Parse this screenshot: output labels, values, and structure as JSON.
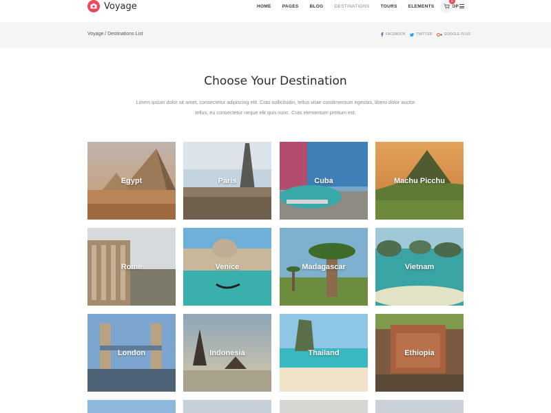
{
  "brand": {
    "name": "Voyage"
  },
  "nav": {
    "items": [
      "HOME",
      "PAGES",
      "BLOG",
      "DESTINATIONS",
      "TOURS",
      "ELEMENTS",
      "SHOP"
    ],
    "active": "DESTINATIONS",
    "cart_count": "0"
  },
  "breadcrumb": {
    "text": "Voyage / Destinations List"
  },
  "social": [
    "FACEBOOK",
    "TWITTER",
    "GOOGLE PLUS"
  ],
  "section": {
    "title": "Choose Your Destination",
    "intro": "Lorem ipsum dolor sit amet, consectetur adipiscing elit. Cras sollicitudin, tellus vitae condimentum egestas, libero dolor auctor tellus, eu consectetur neque elit quis nunc. Cras elementum pretium est."
  },
  "destinations": [
    {
      "name": "Egypt"
    },
    {
      "name": "Paris"
    },
    {
      "name": "Cuba"
    },
    {
      "name": "Machu Picchu"
    },
    {
      "name": "Rome"
    },
    {
      "name": "Venice"
    },
    {
      "name": "Madagascar"
    },
    {
      "name": "Vietnam"
    },
    {
      "name": "London"
    },
    {
      "name": "Indonesia"
    },
    {
      "name": "Thailand"
    },
    {
      "name": "Ethiopia"
    }
  ],
  "colors": {
    "accent": "#e94b5a"
  }
}
